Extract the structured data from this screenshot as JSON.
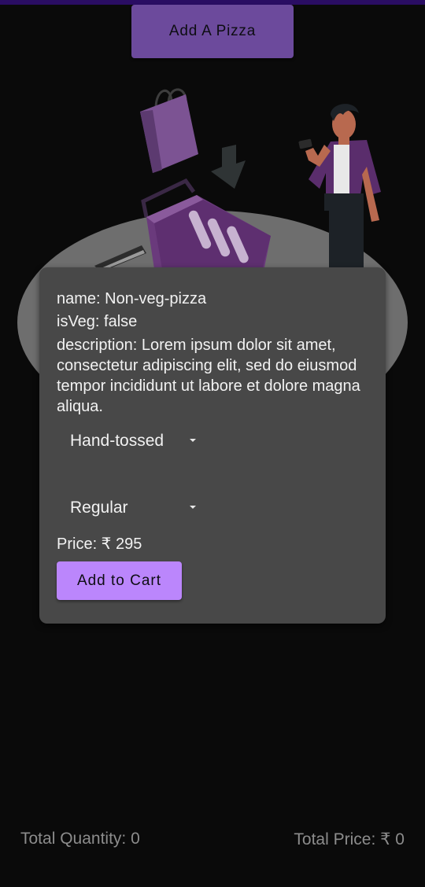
{
  "header": {
    "add_pizza_label": "Add A Pizza"
  },
  "pizza_card": {
    "name_line": "name: Non-veg-pizza",
    "veg_line": "isVeg: false",
    "description_line": "description: Lorem ipsum dolor sit amet, consectetur adipiscing elit, sed do eiusmod tempor incididunt ut labore et dolore magna aliqua.",
    "crust_selected": "Hand-tossed",
    "size_selected": "Regular",
    "price_line": "Price: ₹ 295",
    "add_to_cart_label": "Add to Cart"
  },
  "footer": {
    "total_quantity": "Total Quantity: 0",
    "total_price": "Total Price: ₹ 0"
  },
  "colors": {
    "background": "#0a0a0a",
    "add_pizza_button": "#6c4a9c",
    "card": "#484848",
    "add_to_cart_button": "#bb86fc",
    "footer_text": "#8c8c8c",
    "top_strip": "#2a0d63"
  },
  "illustration": {
    "icons": [
      "shopping-bag-icon",
      "down-arrow-icon",
      "shopping-basket-icon",
      "person-with-phone-icon"
    ]
  }
}
